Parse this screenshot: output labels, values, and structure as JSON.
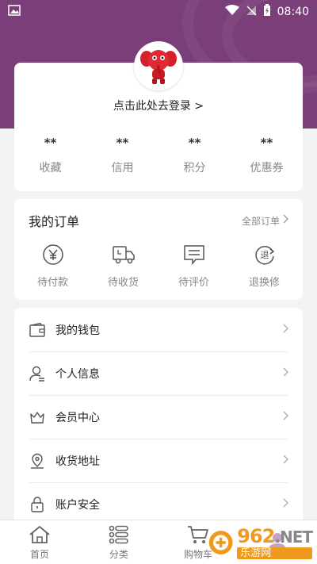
{
  "status_bar": {
    "time": "08:40",
    "battery_glyph": "⚡"
  },
  "profile": {
    "login_text": "点击此处去登录 >",
    "stats": [
      {
        "value": "**",
        "label": "收藏"
      },
      {
        "value": "**",
        "label": "信用"
      },
      {
        "value": "**",
        "label": "积分"
      },
      {
        "value": "**",
        "label": "优惠券"
      }
    ]
  },
  "orders": {
    "title": "我的订单",
    "all_link": "全部订单",
    "items": [
      {
        "label": "待付款",
        "icon": "yen-icon"
      },
      {
        "label": "待收货",
        "icon": "truck-icon"
      },
      {
        "label": "待评价",
        "icon": "comment-icon"
      },
      {
        "label": "退换修",
        "icon": "return-icon"
      }
    ]
  },
  "menu": [
    {
      "label": "我的钱包",
      "icon": "wallet-icon"
    },
    {
      "label": "个人信息",
      "icon": "user-icon"
    },
    {
      "label": "会员中心",
      "icon": "crown-icon"
    },
    {
      "label": "收货地址",
      "icon": "location-icon"
    },
    {
      "label": "账户安全",
      "icon": "lock-icon"
    }
  ],
  "tabbar": [
    {
      "label": "首页",
      "icon": "home-icon"
    },
    {
      "label": "分类",
      "icon": "category-icon"
    },
    {
      "label": "购物车",
      "icon": "cart-icon"
    },
    {
      "label": "",
      "icon": "profile-icon"
    }
  ],
  "watermark": {
    "num": "962",
    "net": ".NET",
    "sub": "乐游网"
  },
  "colors": {
    "header": "#7a3f78",
    "mascot": "#d6202a",
    "watermark": "#f09a1d"
  }
}
